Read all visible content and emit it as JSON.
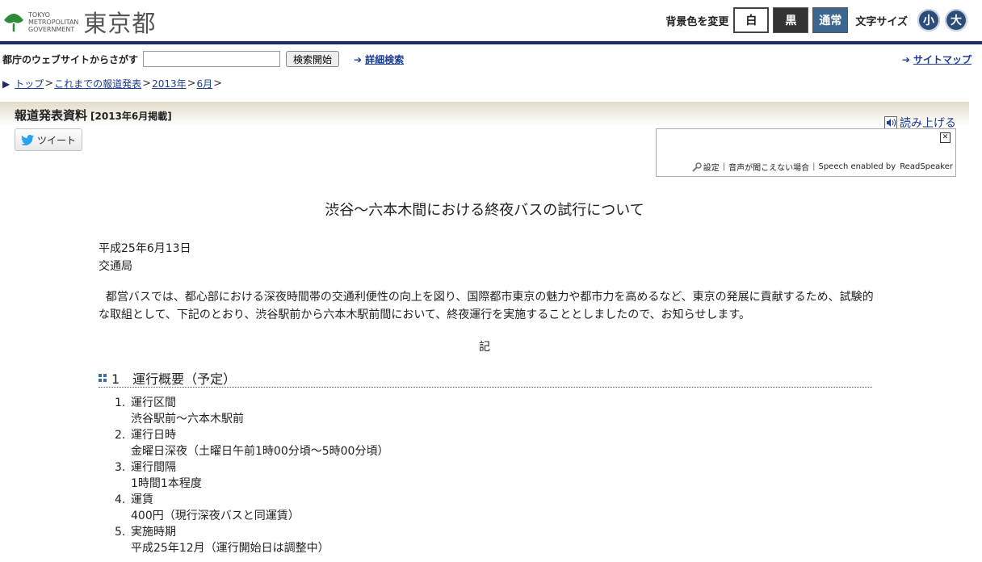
{
  "header": {
    "logo_en": [
      "TOKYO",
      "METROPOLITAN",
      "GOVERNMENT"
    ],
    "logo_ja": "東京都",
    "bg_label": "背景色を変更",
    "bg_white": "白",
    "bg_black": "黒",
    "bg_normal": "通常",
    "size_label": "文字サイズ",
    "size_small": "小",
    "size_large": "大"
  },
  "search": {
    "label": "都庁のウェブサイトからさがす",
    "value": "",
    "button": "検索開始",
    "advanced": "詳細検索",
    "sitemap": "サイトマップ"
  },
  "breadcrumb": [
    "トップ",
    "これまでの報道発表",
    "2013年",
    "6月"
  ],
  "band": {
    "title": "報道発表資料",
    "sub": "[2013年6月掲載]"
  },
  "tweet": "ツイート",
  "readspeaker": {
    "read_aloud": "読み上げる",
    "settings": "設定",
    "cannot_hear": "音声が聞こえない場合",
    "enabled_by": "Speech enabled by",
    "brand": "ReadSpeaker"
  },
  "content": {
    "title": "渋谷～六本木間における終夜バスの試行について",
    "date": "平成25年6月13日",
    "dept": "交通局",
    "intro": "都営バスでは、都心部における深夜時間帯の交通利便性の向上を図り、国際都市東京の魅力や都市力を高めるなど、東京の発展に貢献するため、試験的な取組として、下記のとおり、渋谷駅前から六本木駅前間において、終夜運行を実施することとしましたので、お知らせします。",
    "ki": "記",
    "section_title": "1　運行概要（予定）",
    "items": [
      {
        "num": "1.",
        "label": "運行区間",
        "detail": "渋谷駅前～六本木駅前"
      },
      {
        "num": "2.",
        "label": "運行日時",
        "detail": "金曜日深夜（土曜日午前1時00分頃～5時00分頃）"
      },
      {
        "num": "3.",
        "label": "運行間隔",
        "detail": "1時間1本程度"
      },
      {
        "num": "4.",
        "label": "運賃",
        "detail": "400円（現行深夜バスと同運賃）"
      },
      {
        "num": "5.",
        "label": "実施時期",
        "detail": "平成25年12月（運行開始日は調整中）"
      }
    ]
  },
  "colors": {
    "header_rule": "#1f2a6b",
    "link": "#1a3d8f",
    "band": "#e4dccb"
  }
}
